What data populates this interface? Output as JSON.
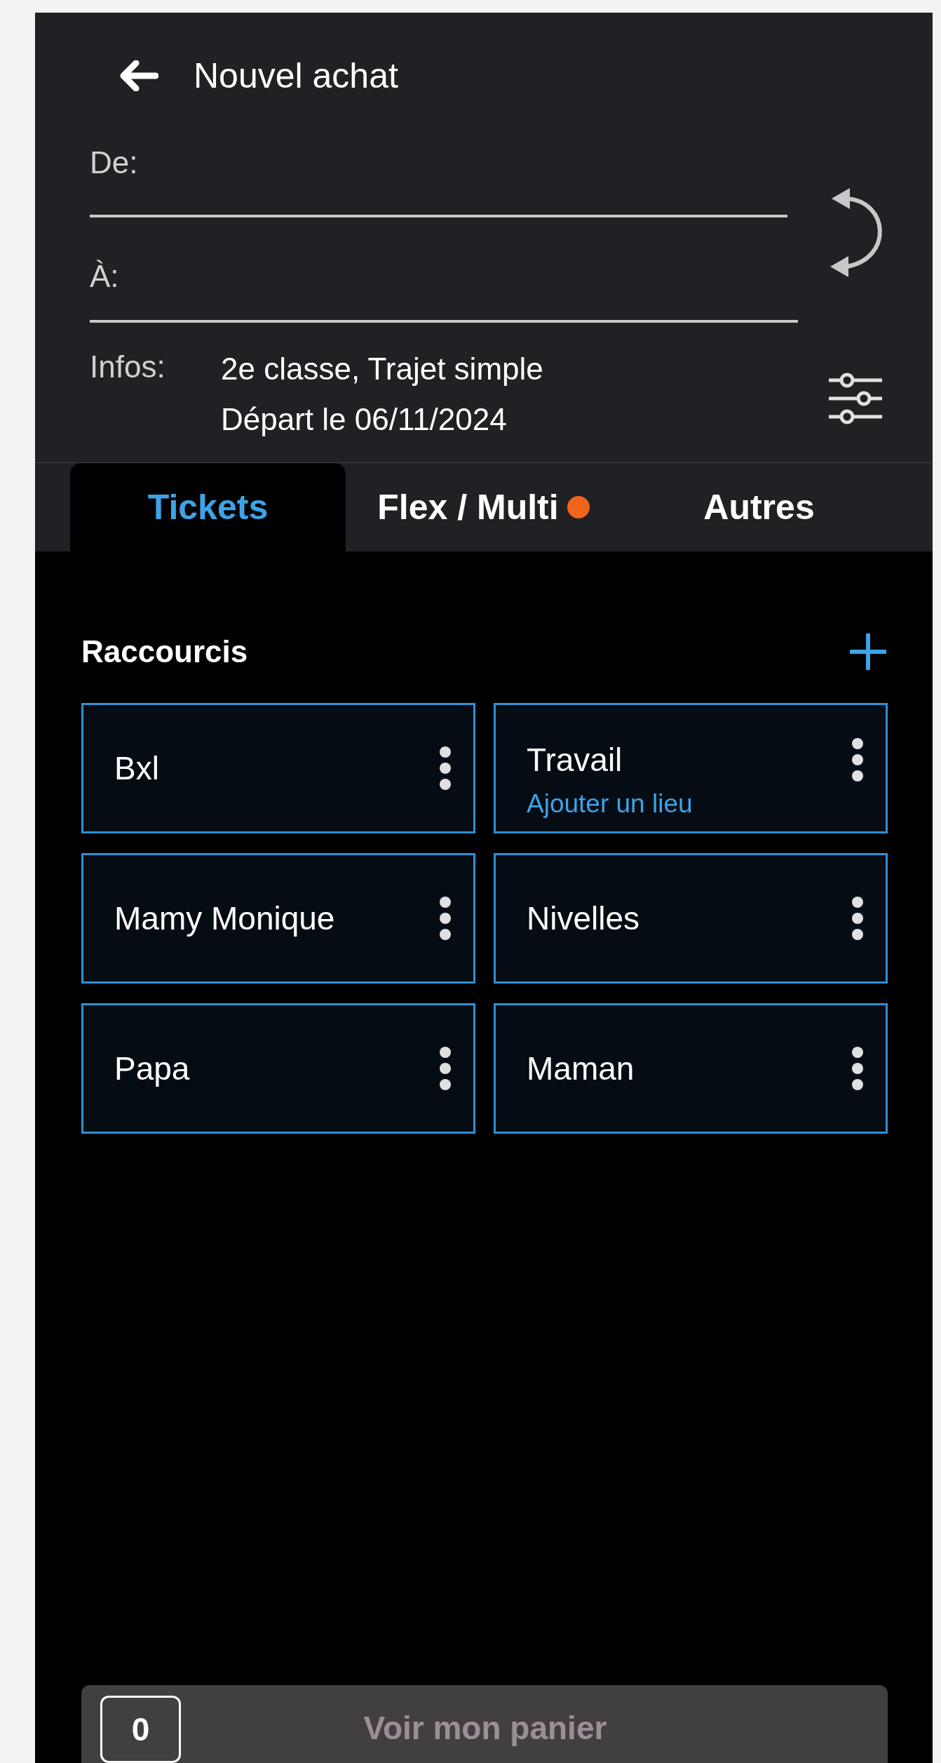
{
  "header": {
    "title": "Nouvel achat"
  },
  "route": {
    "fields": [
      {
        "label": "De:"
      },
      {
        "label": "À:"
      }
    ]
  },
  "infos": {
    "label": "Infos:",
    "lines": [
      "2e classe, Trajet simple",
      "Départ le 06/11/2024"
    ]
  },
  "tabs": [
    {
      "label": "Tickets",
      "selected": true,
      "dot": false
    },
    {
      "label": "Flex / Multi",
      "selected": false,
      "dot": true
    },
    {
      "label": "Autres",
      "selected": false,
      "dot": false
    }
  ],
  "shortcuts": {
    "title": "Raccourcis",
    "items": [
      {
        "label": "Bxl"
      },
      {
        "label": "Travail",
        "sublabel": "Ajouter un lieu"
      },
      {
        "label": "Mamy Monique"
      },
      {
        "label": "Nivelles"
      },
      {
        "label": "Papa"
      },
      {
        "label": "Maman"
      }
    ]
  },
  "cart": {
    "count": "0",
    "label": "Voir mon panier"
  }
}
